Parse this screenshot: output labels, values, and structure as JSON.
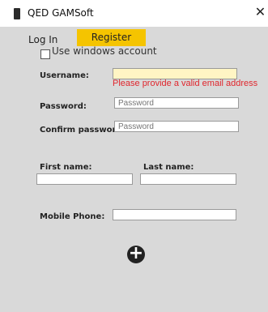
{
  "window": {
    "title": "QED GAMSoft",
    "close_glyph": "✕"
  },
  "tabs": [
    {
      "label": "Log In"
    },
    {
      "label": "Register",
      "selected": true,
      "color": "#f5c400"
    }
  ],
  "windows_account": {
    "label": "Use windows account",
    "checked": false
  },
  "form": {
    "username": {
      "label": "Username:",
      "value": "",
      "error": "Please provide a valid email address"
    },
    "password": {
      "label": "Password:",
      "placeholder": "Password"
    },
    "confirm_password": {
      "label": "Confirm password:",
      "placeholder": "Password"
    },
    "first_name": {
      "label": "First name:",
      "value": ""
    },
    "last_name": {
      "label": "Last name:",
      "value": ""
    },
    "mobile_phone": {
      "label": "Mobile Phone:",
      "value": ""
    }
  },
  "add_button": {
    "icon": "plus-circle-icon",
    "glyph": "+"
  },
  "colors": {
    "accent": "#f5c400",
    "error": "#e0262d",
    "error_field": "#fff5c4",
    "background": "#d9d9d9"
  }
}
